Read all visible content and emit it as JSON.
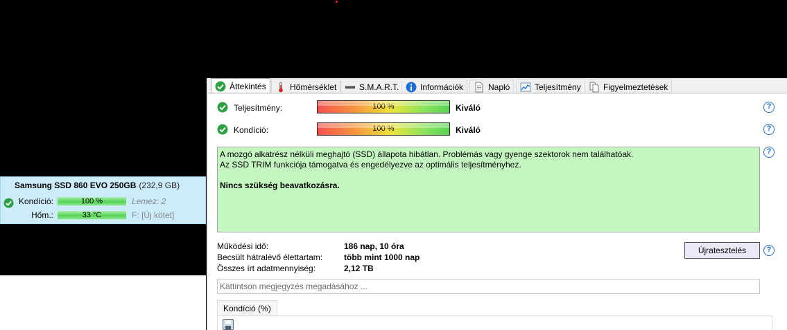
{
  "drive": {
    "name": "Samsung SSD 860 EVO 250GB",
    "size": "(232,9 GB)",
    "health_label": "Kondíció:",
    "health_value": "100 %",
    "health_percent": 100,
    "disk_info": "Lemez: 2",
    "temp_label": "Hőm.:",
    "temp_value": "33 °C",
    "volume_info": "F: [Új kötet]"
  },
  "tabs": [
    {
      "label": "Áttekintés",
      "icon": "check-icon",
      "active": true
    },
    {
      "label": "Hőmérséklet",
      "icon": "thermometer-icon"
    },
    {
      "label": "S.M.A.R.T.",
      "icon": "drive-icon"
    },
    {
      "label": "Információk",
      "icon": "info-icon"
    },
    {
      "label": "Napló",
      "icon": "document-icon"
    },
    {
      "label": "Teljesítmény",
      "icon": "chart-icon"
    },
    {
      "label": "Figyelmeztetések",
      "icon": "alerts-icon"
    }
  ],
  "overview": {
    "performance_label": "Teljesítmény:",
    "performance_value": "100 %",
    "performance_percent": 100,
    "performance_rating": "Kiváló",
    "health_label": "Kondíció:",
    "health_value": "100 %",
    "health_percent": 100,
    "health_rating": "Kiváló",
    "help_symbol": "?",
    "status_line1": "A mozgó alkatrész nélküli meghajtó (SSD) állapota hibátlan. Problémás vagy gyenge szektorok nem találhatóak.",
    "status_line2": "Az SSD TRIM funkciója támogatva és engedélyezve az optimális teljesítményhez.",
    "status_action": "Nincs szükség beavatkozásra.",
    "uptime_label": "Működési idő:",
    "uptime_value": "186 nap, 10 óra",
    "lifetime_label": "Becsült hátralévő élettartam:",
    "lifetime_value": "több mint 1000 nap",
    "written_label": "Összes írt adatmennyiség:",
    "written_value": "2,12 TB",
    "retest_button": "Újratesztelés",
    "note_placeholder": "Kattintson megjegyzés megadásához ...",
    "chart_tab": "Kondíció  (%)"
  },
  "colors": {
    "status_bg": "#c4f7bf",
    "selected_drive_bg": "#ccecfb",
    "help_blue": "#1f6fd1",
    "check_green": "#2ea043"
  }
}
